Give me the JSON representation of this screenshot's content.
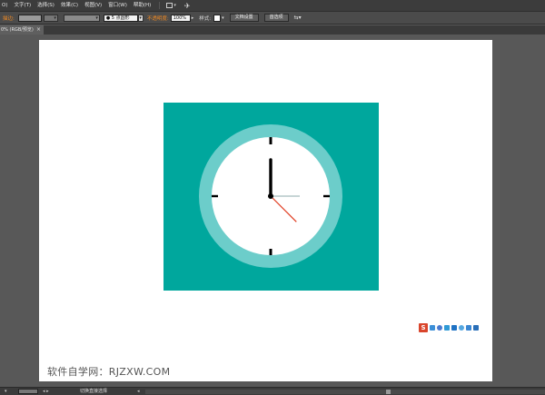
{
  "menubar": {
    "items": [
      "O)",
      "文字(T)",
      "选择(S)",
      "效果(C)",
      "视图(V)",
      "窗口(W)",
      "帮助(H)"
    ]
  },
  "controlbar": {
    "stroke_label": "描边:",
    "brush_value": "● 5 点圆形",
    "opacity_label": "不透明度:",
    "opacity_value": "100%",
    "style_label": "样式:",
    "doc_setup_label": "文档设置",
    "prefs_label": "首选项"
  },
  "document": {
    "tab_label": "0% (RGB/预览)"
  },
  "artboard": {
    "watermark": "软件自学网：RJZXW.COM"
  },
  "clock": {
    "hour": 4,
    "minute": 0,
    "second": 15,
    "colors": {
      "background": "#00a79d",
      "rim": "#6ccdca",
      "face": "#ffffff",
      "hands": "#000000",
      "second_hand": "#e03a1e",
      "ticks": "#000000"
    }
  },
  "tray": {
    "logo": "S",
    "icons": [
      "cloud-icon",
      "moon-icon",
      "note-icon",
      "keyboard-icon",
      "person-icon",
      "shirt-icon",
      "wrench-icon"
    ]
  },
  "statusbar": {
    "tool_text": "切换直接选择"
  },
  "colors": {
    "app_background": "#5a5a5a",
    "menubar": "#3c3c3c",
    "accent_orange": "#f08a24"
  }
}
